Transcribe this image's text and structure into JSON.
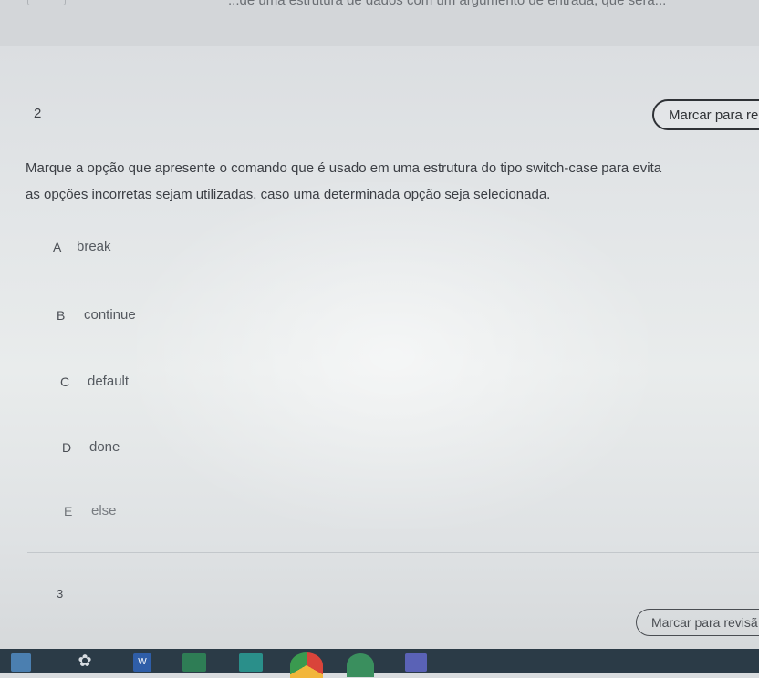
{
  "top": {
    "partial_text": "...de uma estrutura de dados com um argumento de entrada, que será..."
  },
  "question": {
    "number": "2",
    "review_button_label": "Marcar para re",
    "text_lines": [
      "Marque a opção que apresente o comando que é usado em uma estrutura do tipo switch-case para evita",
      "as opções incorretas sejam utilizadas, caso uma determinada opção seja selecionada."
    ],
    "options": [
      {
        "letter": "A",
        "text": "break"
      },
      {
        "letter": "B",
        "text": "continue"
      },
      {
        "letter": "C",
        "text": "default"
      },
      {
        "letter": "D",
        "text": "done"
      },
      {
        "letter": "E",
        "text": "else"
      }
    ]
  },
  "next_question": {
    "number": "3",
    "review_button_label": "Marcar para revisã"
  },
  "taskbar": {
    "icons": [
      "windows-start-icon",
      "gear-icon",
      "word-icon",
      "excel-icon",
      "app-icon",
      "chrome-icon",
      "whatsapp-icon",
      "teams-icon"
    ],
    "word_label": "W"
  }
}
